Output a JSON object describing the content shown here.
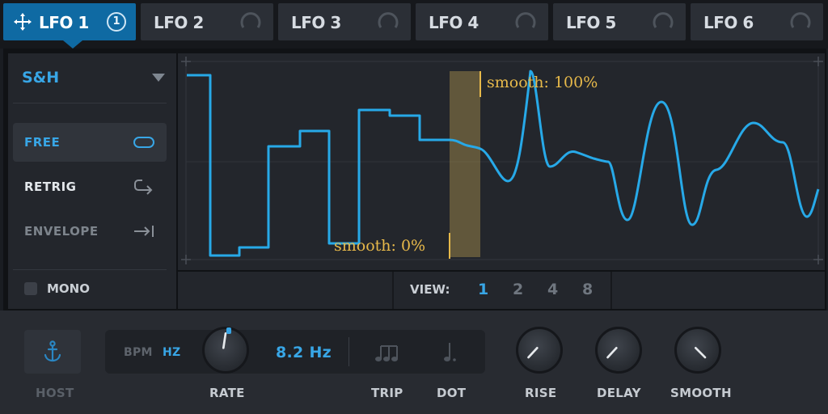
{
  "tabs": [
    {
      "label": "LFO 1",
      "badge": "1"
    },
    {
      "label": "LFO 2"
    },
    {
      "label": "LFO 3"
    },
    {
      "label": "LFO 4"
    },
    {
      "label": "LFO 5"
    },
    {
      "label": "LFO 6"
    }
  ],
  "waveform": {
    "selected": "S&H"
  },
  "modes": [
    {
      "label": "FREE"
    },
    {
      "label": "RETRIG"
    },
    {
      "label": "ENVELOPE"
    }
  ],
  "mono": {
    "label": "MONO"
  },
  "view": {
    "label": "VIEW:",
    "options": [
      "1",
      "2",
      "4",
      "8"
    ],
    "selected": "1"
  },
  "annotations": {
    "smooth_max": "smooth: 100%",
    "smooth_min": "smooth: 0%"
  },
  "controls": {
    "host": "HOST",
    "bpm": "BPM",
    "hz": "HZ",
    "rate_value": "8.2 Hz",
    "rate": "RATE",
    "trip": "TRIP",
    "dot": "DOT",
    "rise": "RISE",
    "delay": "DELAY",
    "smooth": "SMOOTH"
  },
  "colors": {
    "accent": "#38a6e6",
    "tab_active": "#0f6aa3",
    "annotation": "#e7b94a",
    "wave": "#27a9e8"
  }
}
